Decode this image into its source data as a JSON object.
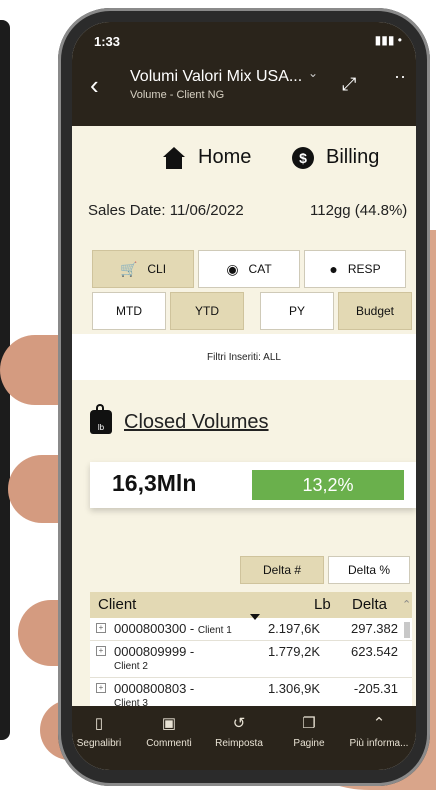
{
  "status": {
    "time": "1:33",
    "icons": "▮▮▮ •"
  },
  "appbar": {
    "title": "Volumi Valori Mix USA...",
    "subtitle": "Volume - Client NG"
  },
  "nav": {
    "home": "Home",
    "billing": "Billing"
  },
  "sales": {
    "date": "Sales Date: 11/06/2022",
    "days": "112gg (44.8%)"
  },
  "buttons": {
    "cli": "CLI",
    "cat": "CAT",
    "resp": "RESP",
    "mtd": "MTD",
    "ytd": "YTD",
    "py": "PY",
    "budget": "Budget"
  },
  "filters": "Filtri Inseriti: ALL",
  "closed": {
    "title": "Closed Volumes",
    "weight_label": "lb",
    "value": "16,3Mln",
    "pct": "13,2%"
  },
  "delta_buttons": {
    "hash": "Delta #",
    "pct": "Delta %"
  },
  "table": {
    "headers": {
      "client": "Client",
      "lb": "Lb",
      "delta": "Delta"
    },
    "rows": [
      {
        "code": "0000800300 - ",
        "name": "Client 1",
        "lb": "2.197,6K",
        "delta": "297.382"
      },
      {
        "code": "0000809999 -",
        "name": "Client 2",
        "lb": "1.779,2K",
        "delta": "623.542"
      },
      {
        "code": "0000800803 -",
        "name": "Client 3",
        "lb": "1.306,9K",
        "delta": "-205.31"
      }
    ]
  },
  "bottombar": {
    "bookmarks": "Segnalibri",
    "comments": "Commenti",
    "reset": "Reimposta",
    "pages": "Pagine",
    "more": "Più informa..."
  },
  "colors": {
    "appbar": "#2a241b",
    "selected": "#e3d9b4",
    "kpi_bar": "#6ab04c",
    "content_bg": "#f7f3e3"
  }
}
